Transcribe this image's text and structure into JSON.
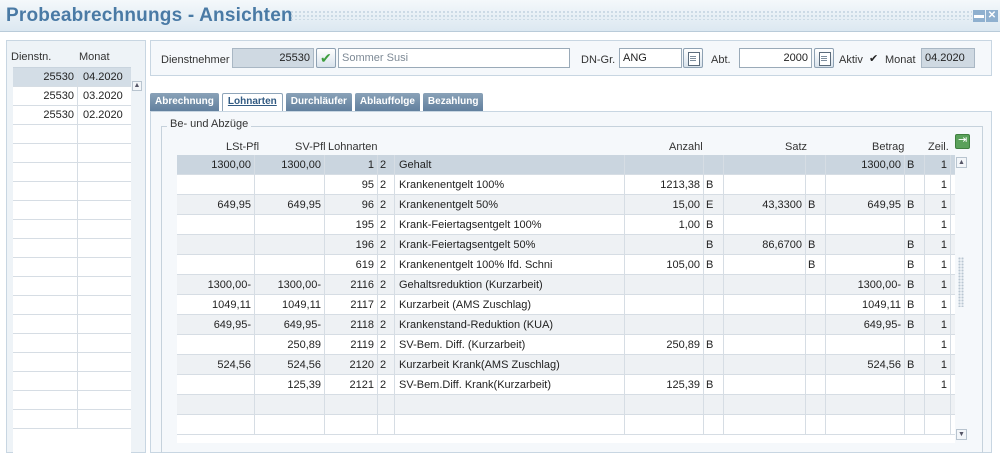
{
  "window": {
    "title": "Probeabrechnungs - Ansichten",
    "controls": [
      "▬",
      "✕"
    ]
  },
  "left": {
    "headers": {
      "dienstn": "Dienstn.",
      "monat": "Monat"
    },
    "rows": [
      {
        "dienstn": "25530",
        "monat": "04.2020",
        "selected": true
      },
      {
        "dienstn": "25530",
        "monat": "03.2020",
        "selected": false
      },
      {
        "dienstn": "25530",
        "monat": "02.2020",
        "selected": false
      }
    ],
    "empty_rows": 16
  },
  "header": {
    "dienstnehmer_label": "Dienstnehmer",
    "dienstnehmer_value": "25530",
    "name_value": "Sommer Susi",
    "dngr_label": "DN-Gr.",
    "dngr_value": "ANG",
    "abt_label": "Abt.",
    "abt_value": "2000",
    "aktiv_label": "Aktiv",
    "aktiv_mark": "✔",
    "monat_label": "Monat",
    "monat_value": "04.2020"
  },
  "tabs": [
    {
      "label": "Abrechnung",
      "active": false
    },
    {
      "label": "Lohnarten",
      "active": true
    },
    {
      "label": "Durchläufer",
      "active": false
    },
    {
      "label": "Ablauffolge",
      "active": false
    },
    {
      "label": "Bezahlung",
      "active": false
    }
  ],
  "section": {
    "title": "Be- und Abzüge",
    "columns": {
      "lst": "LSt-Pfl",
      "sv": "SV-Pfl",
      "la": "Lohnarten",
      "anzahl": "Anzahl",
      "satz": "Satz",
      "betrag": "Betrag",
      "zeil": "Zeil."
    },
    "rows": [
      {
        "lst": "1300,00",
        "sv": "1300,00",
        "nr": "1",
        "t": "2",
        "desc": "Gehalt",
        "anzahl": "",
        "af": "",
        "satz": "",
        "sf": "",
        "betrag": "1300,00",
        "bf": "B",
        "zeil": "1"
      },
      {
        "lst": "",
        "sv": "",
        "nr": "95",
        "t": "2",
        "desc": "Krankenentgelt 100%",
        "anzahl": "1213,38",
        "af": "B",
        "satz": "",
        "sf": "",
        "betrag": "",
        "bf": "",
        "zeil": "1"
      },
      {
        "lst": "649,95",
        "sv": "649,95",
        "nr": "96",
        "t": "2",
        "desc": "Krankenentgelt 50%",
        "anzahl": "15,00",
        "af": "E",
        "satz": "43,3300",
        "sf": "B",
        "betrag": "649,95",
        "bf": "B",
        "zeil": "1"
      },
      {
        "lst": "",
        "sv": "",
        "nr": "195",
        "t": "2",
        "desc": "Krank-Feiertagsentgelt 100%",
        "anzahl": "1,00",
        "af": "B",
        "satz": "",
        "sf": "",
        "betrag": "",
        "bf": "",
        "zeil": "1"
      },
      {
        "lst": "",
        "sv": "",
        "nr": "196",
        "t": "2",
        "desc": "Krank-Feiertagsentgelt 50%",
        "anzahl": "",
        "af": "B",
        "satz": "86,6700",
        "sf": "B",
        "betrag": "",
        "bf": "B",
        "zeil": "1"
      },
      {
        "lst": "",
        "sv": "",
        "nr": "619",
        "t": "2",
        "desc": "Krankenentgelt 100% lfd. Schni",
        "anzahl": "105,00",
        "af": "B",
        "satz": "",
        "sf": "B",
        "betrag": "",
        "bf": "B",
        "zeil": "1"
      },
      {
        "lst": "1300,00-",
        "sv": "1300,00-",
        "nr": "2116",
        "t": "2",
        "desc": "Gehaltsreduktion (Kurzarbeit)",
        "anzahl": "",
        "af": "",
        "satz": "",
        "sf": "",
        "betrag": "1300,00-",
        "bf": "B",
        "zeil": "1"
      },
      {
        "lst": "1049,11",
        "sv": "1049,11",
        "nr": "2117",
        "t": "2",
        "desc": "Kurzarbeit (AMS Zuschlag)",
        "anzahl": "",
        "af": "",
        "satz": "",
        "sf": "",
        "betrag": "1049,11",
        "bf": "B",
        "zeil": "1"
      },
      {
        "lst": "649,95-",
        "sv": "649,95-",
        "nr": "2118",
        "t": "2",
        "desc": "Krankenstand-Reduktion (KUA)",
        "anzahl": "",
        "af": "",
        "satz": "",
        "sf": "",
        "betrag": "649,95-",
        "bf": "B",
        "zeil": "1"
      },
      {
        "lst": "",
        "sv": "250,89",
        "nr": "2119",
        "t": "2",
        "desc": "SV-Bem. Diff. (Kurzarbeit)",
        "anzahl": "250,89",
        "af": "B",
        "satz": "",
        "sf": "",
        "betrag": "",
        "bf": "",
        "zeil": "1"
      },
      {
        "lst": "524,56",
        "sv": "524,56",
        "nr": "2120",
        "t": "2",
        "desc": "Kurzarbeit Krank(AMS Zuschlag)",
        "anzahl": "",
        "af": "",
        "satz": "",
        "sf": "",
        "betrag": "524,56",
        "bf": "B",
        "zeil": "1"
      },
      {
        "lst": "",
        "sv": "125,39",
        "nr": "2121",
        "t": "2",
        "desc": "SV-Bem.Diff. Krank(Kurzarbeit)",
        "anzahl": "125,39",
        "af": "B",
        "satz": "",
        "sf": "",
        "betrag": "",
        "bf": "",
        "zeil": "1"
      }
    ],
    "empty_rows": 2
  },
  "colors": {
    "accent": "#4a7aa5",
    "selected_row": "#cad5df",
    "tab": "#6f8aa5"
  }
}
